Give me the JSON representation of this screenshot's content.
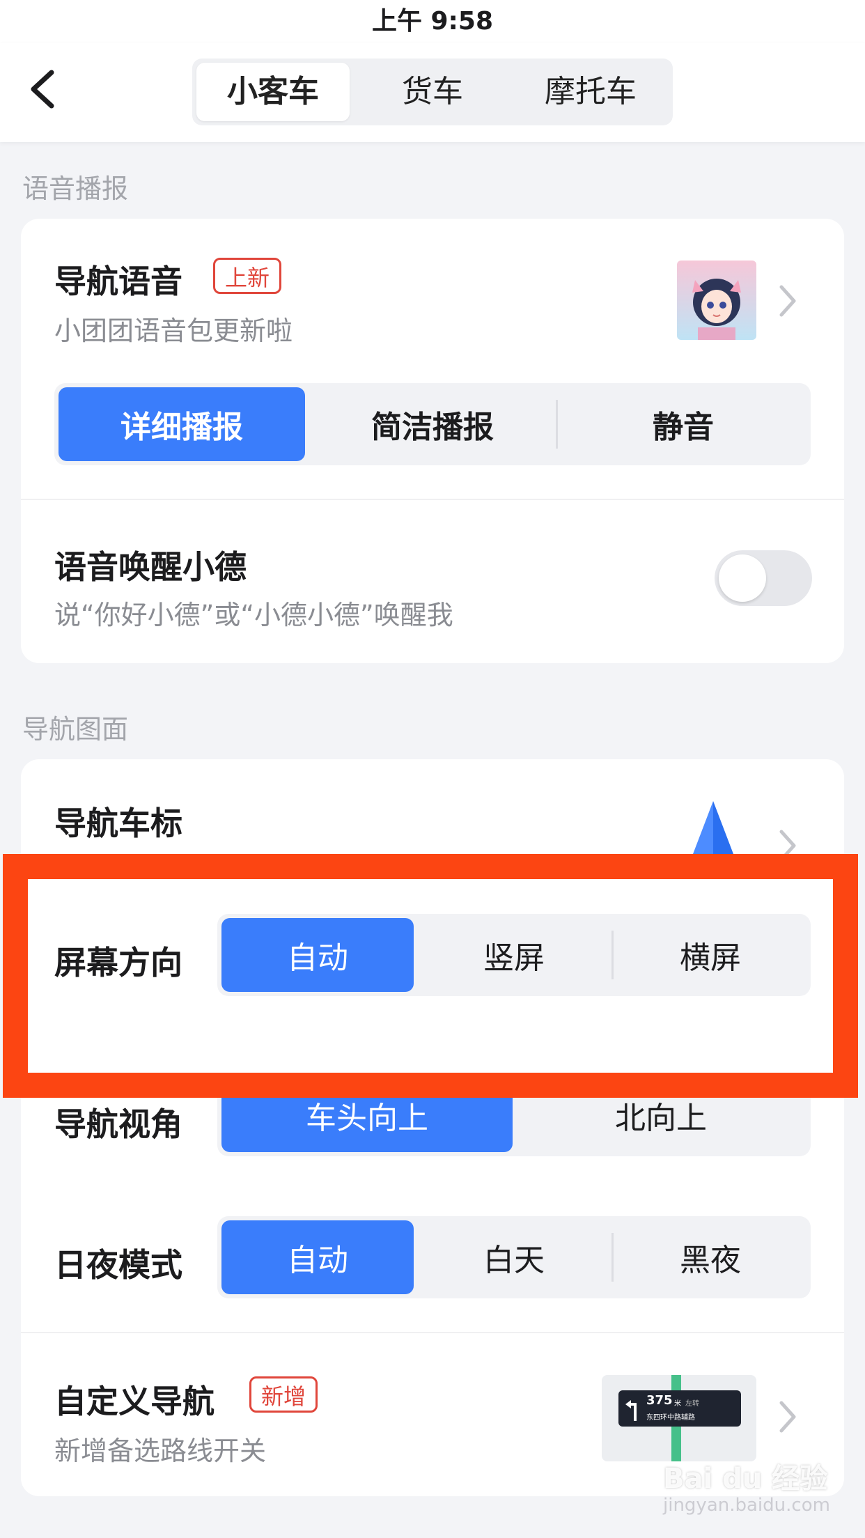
{
  "status_bar": {
    "time": "上午 9:58"
  },
  "header": {
    "tabs": [
      "小客车",
      "货车",
      "摩托车"
    ],
    "active_tab": 0
  },
  "voice_section": {
    "title": "语音播报",
    "nav_voice": {
      "title": "导航语音",
      "badge": "上新",
      "subtitle": "小团团语音包更新啦"
    },
    "broadcast_options": [
      "详细播报",
      "简洁播报",
      "静音"
    ],
    "broadcast_active": 0,
    "wake": {
      "title": "语音唤醒小德",
      "subtitle": "说“你好小德”或“小德小德”唤醒我",
      "enabled": false
    }
  },
  "map_section": {
    "title": "导航图面",
    "car_icon": {
      "title": "导航车标"
    },
    "orientation": {
      "label": "屏幕方向",
      "options": [
        "自动",
        "竖屏",
        "横屏"
      ],
      "active": 0
    },
    "view_angle": {
      "label": "导航视角",
      "options": [
        "车头向上",
        "北向上"
      ],
      "active": 0
    },
    "day_night": {
      "label": "日夜模式",
      "options": [
        "自动",
        "白天",
        "黑夜"
      ],
      "active": 0
    },
    "custom_nav": {
      "title": "自定义导航",
      "badge": "新增",
      "subtitle": "新增备选路线开关",
      "preview": {
        "distance": "375",
        "unit": "米",
        "turn": "左转",
        "road": "东四环中路辅路"
      }
    }
  },
  "watermark": {
    "text": "Bai du 经验",
    "url": "jingyan.baidu.com"
  },
  "colors": {
    "accent": "#3a7dfb",
    "badge": "#e0463b",
    "highlight": "#fc4512"
  }
}
